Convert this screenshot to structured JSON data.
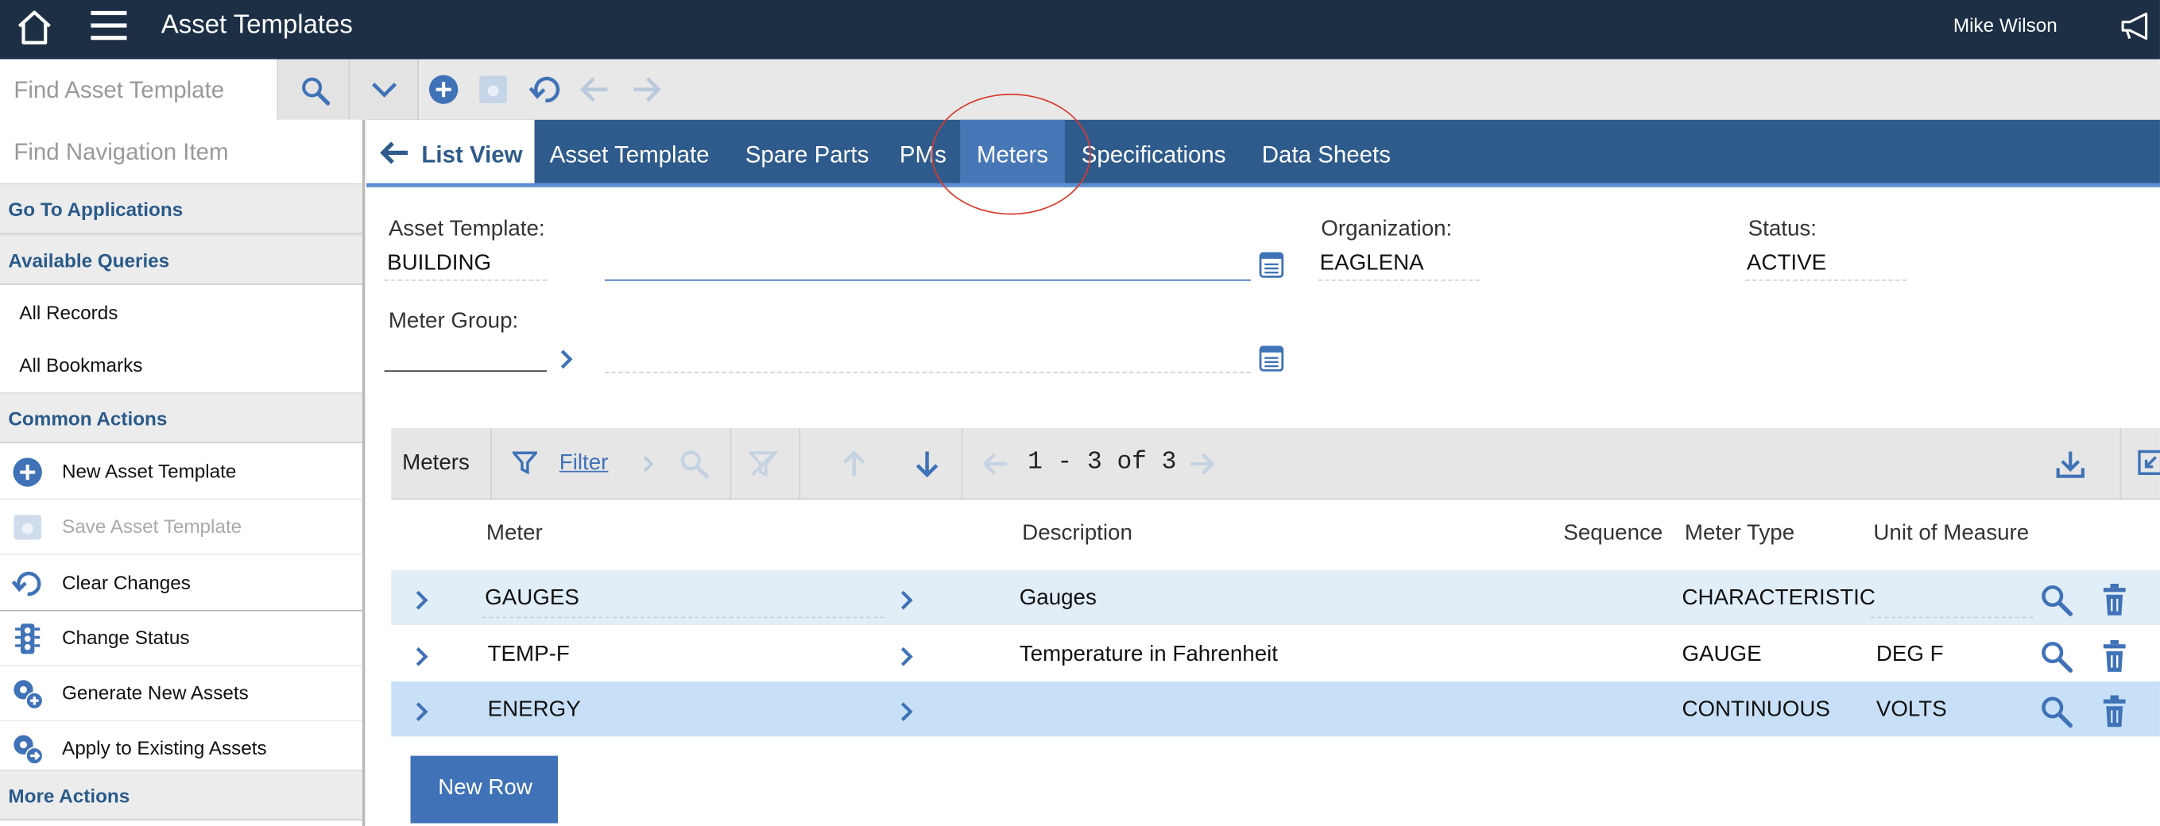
{
  "header": {
    "app_title": "Asset Templates",
    "user_name": "Mike Wilson",
    "home_icon": "home-icon",
    "menu_icon": "hamburger-menu-icon",
    "announce_icon": "megaphone-icon"
  },
  "toolbar": {
    "find_placeholder": "Find Asset Template",
    "icons": [
      "search-icon",
      "chevron-down-icon",
      "add-icon",
      "save-icon",
      "undo-icon",
      "arrow-left-icon",
      "arrow-right-icon"
    ]
  },
  "nav": {
    "find_placeholder": "Find Navigation Item",
    "go_to_applications": "Go To Applications",
    "available_queries": "Available Queries",
    "queries": [
      "All Records",
      "All Bookmarks"
    ],
    "common_actions": "Common Actions",
    "actions": [
      {
        "label": "New Asset Template",
        "icon": "add-icon",
        "enabled": true
      },
      {
        "label": "Save Asset Template",
        "icon": "save-icon",
        "enabled": false
      },
      {
        "label": "Clear Changes",
        "icon": "undo-icon",
        "enabled": true
      },
      {
        "label": "Change Status",
        "icon": "traffic-light-icon",
        "enabled": true
      },
      {
        "label": "Generate New Assets",
        "icon": "generate-assets-icon",
        "enabled": true
      },
      {
        "label": "Apply to Existing Assets",
        "icon": "apply-assets-icon",
        "enabled": true
      }
    ],
    "more_actions": "More Actions"
  },
  "tabs": {
    "list_view": "List View",
    "items": [
      "Asset Template",
      "Spare Parts",
      "PMs",
      "Meters",
      "Specifications",
      "Data Sheets"
    ],
    "active": "Meters"
  },
  "form": {
    "asset_template_label": "Asset Template:",
    "asset_template_value": "BUILDING",
    "description_value": "",
    "organization_label": "Organization:",
    "organization_value": "EAGLENA",
    "status_label": "Status:",
    "status_value": "ACTIVE",
    "meter_group_label": "Meter Group:",
    "meter_group_value": ""
  },
  "meters_table": {
    "title": "Meters",
    "filter_label": "Filter",
    "pagination": "1 - 3 of 3",
    "columns": [
      "Meter",
      "Description",
      "Sequence",
      "Meter Type",
      "Unit of Measure"
    ],
    "rows": [
      {
        "meter": "GAUGES",
        "description": "Gauges",
        "sequence": "",
        "meter_type": "CHARACTERISTIC",
        "unit": ""
      },
      {
        "meter": "TEMP-F",
        "description": "Temperature in Fahrenheit",
        "sequence": "",
        "meter_type": "GAUGE",
        "unit": "DEG F"
      },
      {
        "meter": "ENERGY",
        "description": "",
        "sequence": "",
        "meter_type": "CONTINUOUS",
        "unit": "VOLTS"
      }
    ],
    "new_row_label": "New Row"
  },
  "colors": {
    "topbar": "#1c2f45",
    "tabbar": "#2e5b8c",
    "active_tab": "#4877b8",
    "accent": "#3f72b6",
    "row_highlight": "#e1eef8",
    "row_selected": "#c8e0f7",
    "annotation_circle": "#d63a2c"
  }
}
